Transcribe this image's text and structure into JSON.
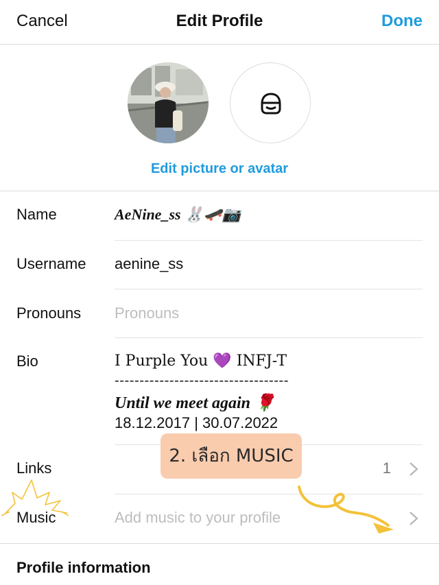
{
  "header": {
    "cancel_label": "Cancel",
    "title": "Edit Profile",
    "done_label": "Done"
  },
  "avatar": {
    "edit_label": "Edit picture or avatar",
    "avatar_icon": "avatar-face-icon"
  },
  "fields": {
    "name": {
      "label": "Name",
      "value": "AeNine_ss 🐰🛹📷"
    },
    "username": {
      "label": "Username",
      "value": "aenine_ss"
    },
    "pronouns": {
      "label": "Pronouns",
      "placeholder": "Pronouns"
    },
    "bio": {
      "label": "Bio",
      "line1": "I Purple You 💜 INFJ-T",
      "line2": "-----------------------------------",
      "line3": "Until we meet again 🌹",
      "line4": "18.12.2017 | 30.07.2022"
    },
    "links": {
      "label": "Links",
      "count": "1"
    },
    "music": {
      "label": "Music",
      "placeholder": "Add music to your profile"
    }
  },
  "section": {
    "profile_information": "Profile information"
  },
  "annotation": {
    "callout": "2. เลือก MUSIC"
  },
  "colors": {
    "accent": "#1f9bde",
    "callout_bg": "#f9ccae",
    "annotation": "#f3c23a"
  }
}
